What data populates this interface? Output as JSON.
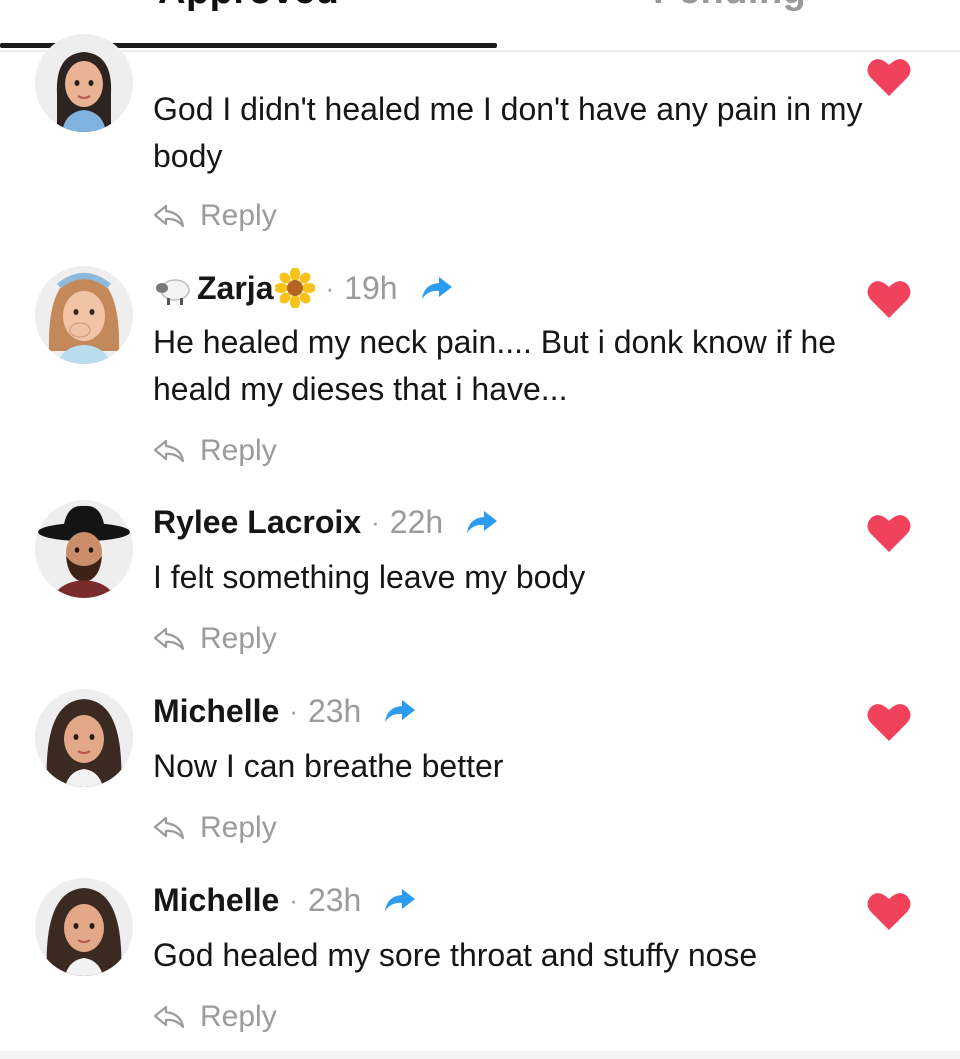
{
  "tabs": {
    "approved": "Approved",
    "pending": "Pending"
  },
  "colors": {
    "heart": "#f0425a",
    "share": "#2d9cf0",
    "muted": "#9b9b9b"
  },
  "comments": [
    {
      "author": "",
      "time": "",
      "text": "God I didn't  healed me I don't have any pain in my body",
      "reply": "Reply",
      "avatar": "woman-dark-hair-avatar"
    },
    {
      "author": "Zarja",
      "time": "19h",
      "text": "He healed my neck pain.... But i donk know if he heald my dieses that i have...",
      "reply": "Reply",
      "avatar": "woman-blonde-headband-avatar",
      "prefix_emoji": "sheep-emoji",
      "suffix_emoji": "sunflower-emoji"
    },
    {
      "author": "Rylee Lacroix",
      "time": "22h",
      "text": "I felt something leave my body",
      "reply": "Reply",
      "avatar": "man-cowboy-hat-avatar"
    },
    {
      "author": "Michelle",
      "time": "23h",
      "text": "Now I can breathe better",
      "reply": "Reply",
      "avatar": "woman-long-hair-avatar"
    },
    {
      "author": "Michelle",
      "time": "23h",
      "text": "God healed my sore throat and stuffy nose",
      "reply": "Reply",
      "avatar": "woman-long-hair-avatar"
    }
  ]
}
